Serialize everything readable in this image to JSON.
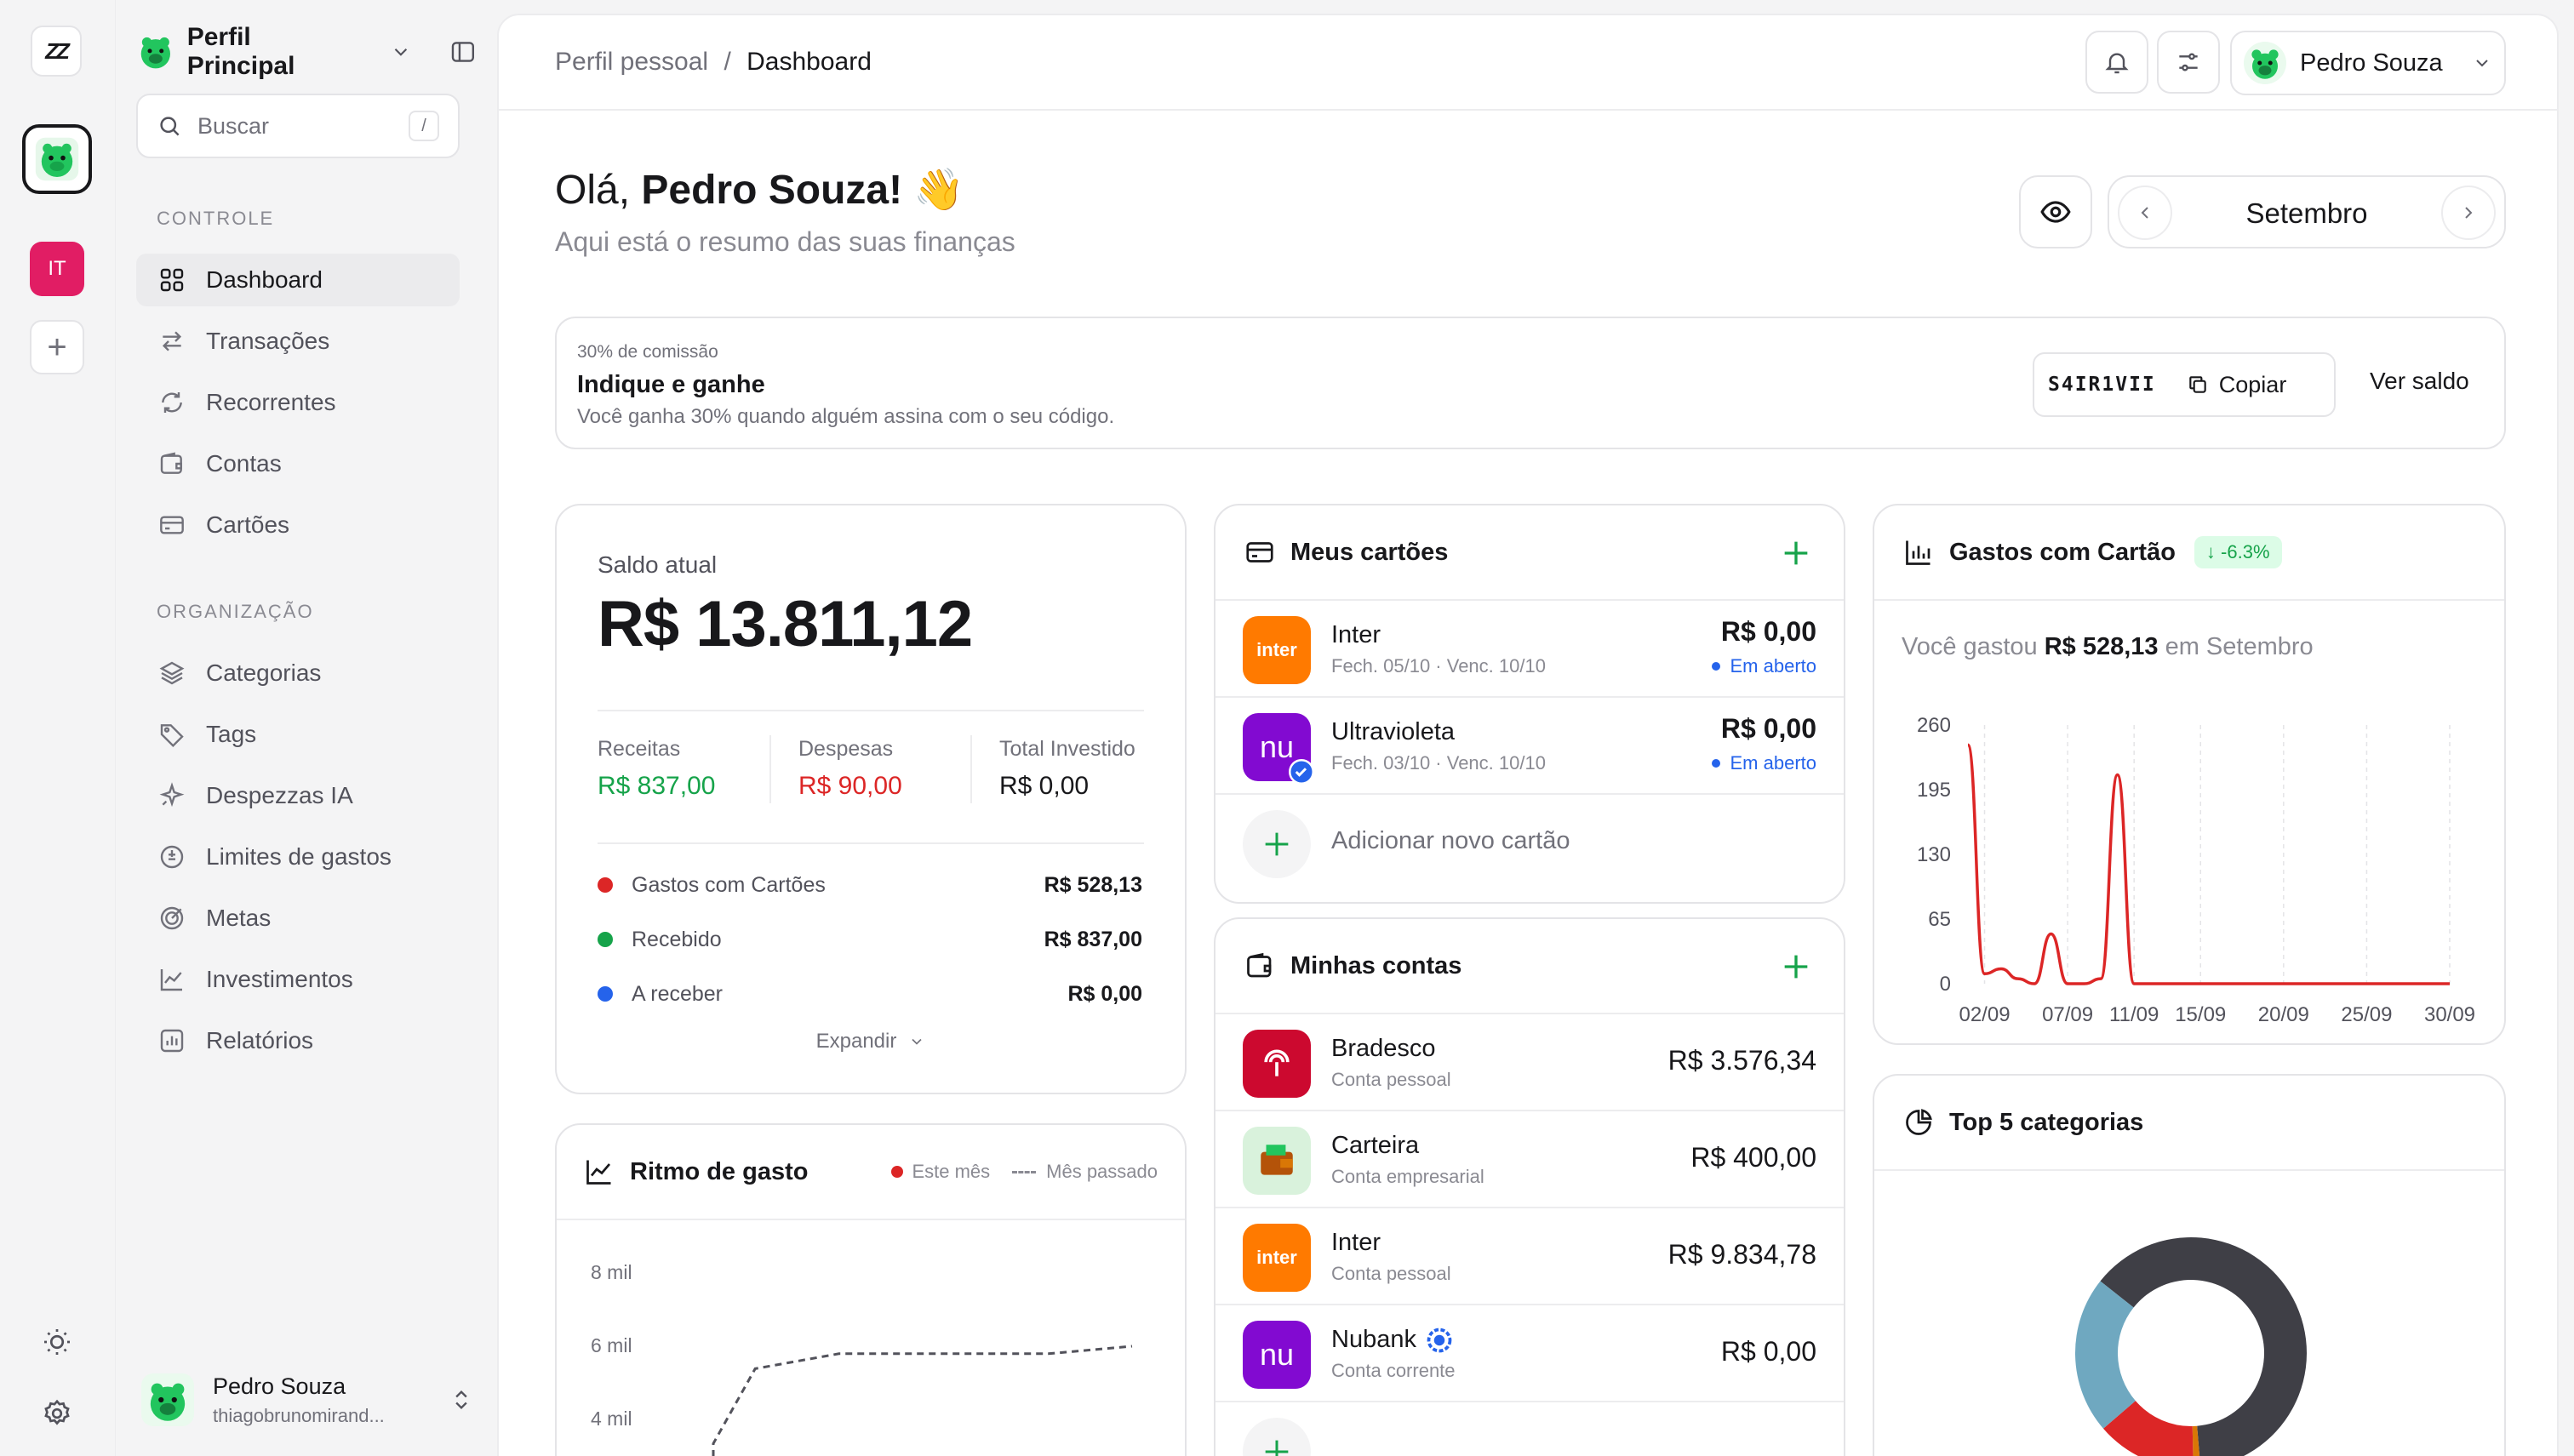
{
  "rail": {
    "logo": "ZZ",
    "workspace_initials": "IT"
  },
  "sidebar": {
    "profile_name": "Perfil Principal",
    "search_placeholder": "Buscar",
    "search_shortcut": "/",
    "section_controle": "CONTROLE",
    "section_organizacao": "ORGANIZAÇÃO",
    "controle_items": [
      {
        "label": "Dashboard",
        "icon": "grid-icon"
      },
      {
        "label": "Transações",
        "icon": "arrows-icon"
      },
      {
        "label": "Recorrentes",
        "icon": "repeat-icon"
      },
      {
        "label": "Contas",
        "icon": "wallet-icon"
      },
      {
        "label": "Cartões",
        "icon": "card-icon"
      }
    ],
    "org_items": [
      {
        "label": "Categorias",
        "icon": "layers-icon"
      },
      {
        "label": "Tags",
        "icon": "tag-icon"
      },
      {
        "label": "Despezzas IA",
        "icon": "sparkle-icon"
      },
      {
        "label": "Limites de gastos",
        "icon": "limit-icon"
      },
      {
        "label": "Metas",
        "icon": "target-icon"
      },
      {
        "label": "Investimentos",
        "icon": "trend-icon"
      },
      {
        "label": "Relatórios",
        "icon": "report-icon"
      }
    ],
    "user": {
      "name": "Pedro Souza",
      "email": "thiagobrunomirand..."
    }
  },
  "topbar": {
    "breadcrumb_parent": "Perfil pessoal",
    "breadcrumb_sep": "/",
    "breadcrumb_current": "Dashboard",
    "user_name": "Pedro Souza"
  },
  "greeting": {
    "hello": "Olá,",
    "name": "Pedro Souza!",
    "emoji": "👋",
    "subtitle": "Aqui está o resumo das suas finanças",
    "month": "Setembro"
  },
  "referral": {
    "eyebrow": "30% de comissão",
    "title": "Indique e ganhe",
    "desc": "Você ganha 30% quando alguém assina com o seu código.",
    "code": "S4IR1VII",
    "copy_label": "Copiar",
    "balance_label": "Ver saldo"
  },
  "balance": {
    "label": "Saldo atual",
    "amount": "R$ 13.811,12",
    "stats": [
      {
        "label": "Receitas",
        "value": "R$ 837,00",
        "color": "#16a34a"
      },
      {
        "label": "Despesas",
        "value": "R$ 90,00",
        "color": "#dc2626"
      },
      {
        "label": "Total Investido",
        "value": "R$ 0,00",
        "color": "#18181b"
      }
    ],
    "legend": [
      {
        "label": "Gastos com Cartões",
        "value": "R$ 528,13",
        "color": "#dc2626"
      },
      {
        "label": "Recebido",
        "value": "R$ 837,00",
        "color": "#16a34a"
      },
      {
        "label": "A receber",
        "value": "R$ 0,00",
        "color": "#2563eb"
      }
    ],
    "expand_label": "Expandir"
  },
  "pace": {
    "title": "Ritmo de gasto",
    "legend_current": "Este mês",
    "legend_previous": "Mês passado",
    "yticks": [
      "8 mil",
      "6 mil",
      "4 mil"
    ]
  },
  "cards": {
    "title": "Meus cartões",
    "items": [
      {
        "name": "Inter",
        "meta": "Fech. 05/10 · Venc. 10/10",
        "value": "R$ 0,00",
        "status": "Em aberto",
        "logo": "inter",
        "color": "#ff7a00"
      },
      {
        "name": "Ultravioleta",
        "meta": "Fech. 03/10 · Venc. 10/10",
        "value": "R$ 0,00",
        "status": "Em aberto",
        "logo": "nu",
        "color": "#820ad1"
      }
    ],
    "add_label": "Adicionar novo cartão"
  },
  "accounts": {
    "title": "Minhas contas",
    "items": [
      {
        "name": "Bradesco",
        "type": "Conta pessoal",
        "value": "R$ 3.576,34",
        "logo": "bradesco-icon",
        "color": "#cc092f"
      },
      {
        "name": "Carteira",
        "type": "Conta empresarial",
        "value": "R$ 400,00",
        "logo": "wallet-icon",
        "color": "#d9f2dc"
      },
      {
        "name": "Inter",
        "type": "Conta pessoal",
        "value": "R$ 9.834,78",
        "logo": "inter",
        "color": "#ff7a00"
      },
      {
        "name": "Nubank",
        "type": "Conta corrente",
        "value": "R$ 0,00",
        "logo": "nu",
        "color": "#820ad1"
      }
    ]
  },
  "card_spend": {
    "title": "Gastos com Cartão",
    "badge": "↓ -6.3%",
    "summary_pre": "Você gastou",
    "summary_amount": "R$ 528,13",
    "summary_post": "em Setembro"
  },
  "top_categories": {
    "title": "Top 5 categorias"
  },
  "chart_data": [
    {
      "type": "line",
      "title": "Gastos com Cartão",
      "x_ticks": [
        "02/09",
        "07/09",
        "11/09",
        "15/09",
        "20/09",
        "25/09",
        "30/09"
      ],
      "y_ticks": [
        0,
        65,
        130,
        195,
        260
      ],
      "ylim": [
        0,
        260
      ],
      "grid": true,
      "series": [
        {
          "color": "#dc2626",
          "x": [
            1,
            2,
            3,
            4,
            5,
            6,
            7,
            8,
            9,
            10,
            11,
            12,
            13,
            14,
            15,
            16,
            17,
            18,
            19,
            20,
            21,
            22,
            23,
            24,
            25,
            26,
            27,
            28,
            29,
            30
          ],
          "y": [
            240,
            10,
            15,
            5,
            0,
            50,
            0,
            0,
            5,
            210,
            0,
            0,
            0,
            0,
            0,
            0,
            0,
            0,
            0,
            0,
            0,
            0,
            0,
            0,
            0,
            0,
            0,
            0,
            0,
            0
          ]
        }
      ]
    },
    {
      "type": "line",
      "title": "Ritmo de gasto",
      "y_ticks": [
        "8 mil",
        "6 mil",
        "4 mil"
      ],
      "series": [
        {
          "name": "Este mês",
          "color": "#dc2626",
          "values": []
        },
        {
          "name": "Mês passado",
          "color": "#52525b",
          "values": [
            3400,
            5400,
            5600,
            5800,
            5800,
            5800,
            5800,
            5800,
            5800,
            5900,
            6000
          ]
        }
      ]
    },
    {
      "type": "pie",
      "title": "Top 5 categorias",
      "slices": [
        {
          "color": "#3f3f46",
          "value": 63
        },
        {
          "color": "#d97706",
          "value": 1
        },
        {
          "color": "#dc2626",
          "value": 14
        },
        {
          "color": "#6fa8c0",
          "value": 22
        }
      ]
    }
  ]
}
